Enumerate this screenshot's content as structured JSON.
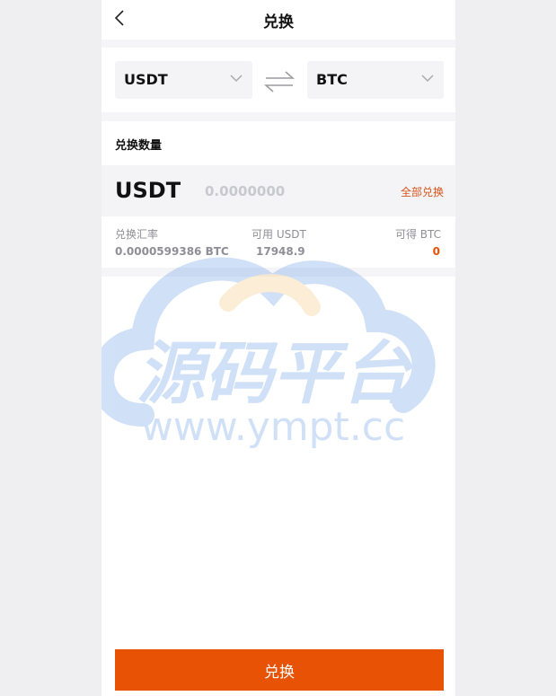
{
  "header": {
    "title": "兑换"
  },
  "pair": {
    "from": "USDT",
    "to": "BTC"
  },
  "quantity": {
    "label": "兑换数量",
    "currency": "USDT",
    "placeholder": "0.0000000",
    "all_label": "全部兑换"
  },
  "info": {
    "rate_label": "兑换汇率",
    "rate_value": "0.0000599386 BTC",
    "available_label": "可用 USDT",
    "available_value": "17948.9",
    "receive_label": "可得 BTC",
    "receive_value": "0"
  },
  "watermark": {
    "logo_text": "源码平台",
    "url_text": "www.ympt.cc"
  },
  "submit_label": "兑换",
  "colors": {
    "accent": "#e85205",
    "watermark_blue": "#5b93e6",
    "watermark_yellow": "#f5c271"
  }
}
